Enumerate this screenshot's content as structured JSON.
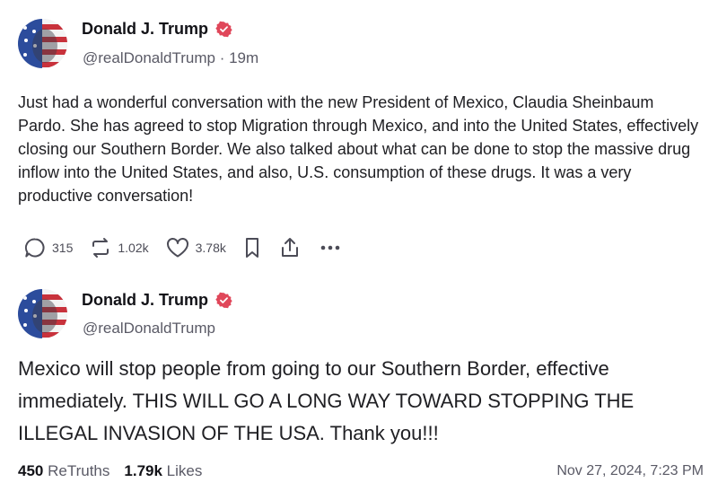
{
  "colors": {
    "badge": "#e0475a",
    "text": "#202024",
    "muted": "#5a5a66",
    "icons": "#4c4c57"
  },
  "post1": {
    "author": "Donald J. Trump",
    "handle": "@realDonaldTrump",
    "separator": " · ",
    "age": "19m",
    "text": "Just had a wonderful conversation with the new President of Mexico, Claudia Sheinbaum Pardo. She has agreed to stop Migration through Mexico, and into the United States, effectively closing our Southern Border. We also talked about what can be done to stop the massive drug inflow into the United States, and also, U.S. consumption of these drugs. It was a very productive conversation!",
    "replies": "315",
    "retruths": "1.02k",
    "likes": "3.78k",
    "icons": [
      "reply-icon",
      "retruth-icon",
      "like-icon",
      "bookmark-icon",
      "share-icon",
      "more-icon"
    ]
  },
  "post2": {
    "author": "Donald J. Trump",
    "handle": "@realDonaldTrump",
    "text": "Mexico will stop people from going to our Southern Border, effective immediately. THIS WILL GO A LONG WAY TOWARD STOPPING THE ILLEGAL INVASION OF THE USA. Thank you!!!",
    "retruths_count": "450",
    "retruths_label": "ReTruths",
    "likes_count": "1.79k",
    "likes_label": "Likes",
    "timestamp": "Nov 27, 2024, 7:23 PM"
  }
}
